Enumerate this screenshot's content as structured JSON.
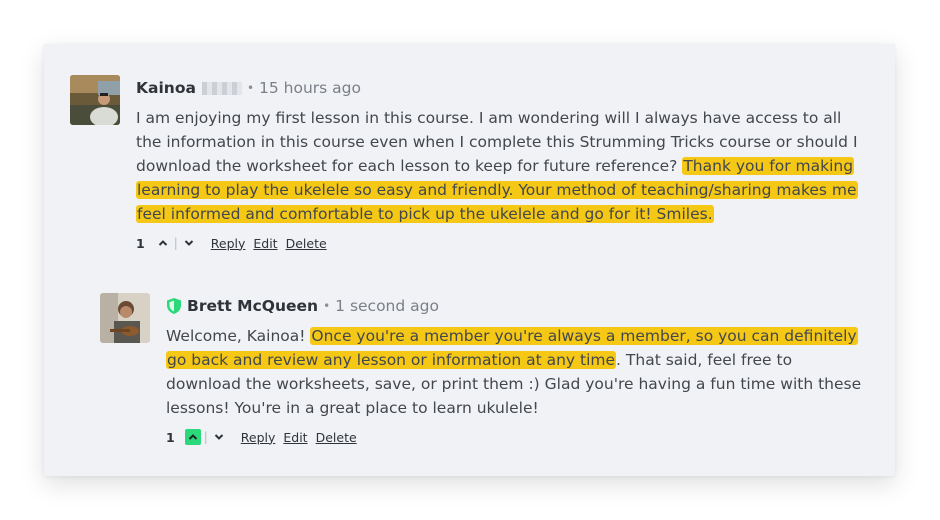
{
  "comments": [
    {
      "author": "Kainoa",
      "time": "15 hours ago",
      "text_plain": "I am enjoying my first lesson in this course. I am wondering will I always have access to all the information in this course even when I complete this Strumming Tricks course or should I download the worksheet for each lesson to keep for future reference? ",
      "text_highlight": "Thank you for making learning to play the ukelele so easy and friendly. Your method of teaching/sharing makes me feel informed and comfortable to pick up the ukelele and go for it! Smiles.",
      "score": "1",
      "upvoted": false,
      "actions": {
        "reply": "Reply",
        "edit": "Edit",
        "delete": "Delete"
      }
    },
    {
      "author": "Brett McQueen",
      "time": "1 second ago",
      "text_intro": "Welcome, Kainoa! ",
      "text_highlight": "Once you're a member you're always a member, so you can definitely go back and review any lesson or information at any time",
      "text_rest": ". That said, feel free to download the worksheets, save, or print them :) Glad you're having a fun time with these lessons! You're in a great place to learn ukulele!",
      "score": "1",
      "upvoted": true,
      "badge_icon": "shield-icon",
      "actions": {
        "reply": "Reply",
        "edit": "Edit",
        "delete": "Delete"
      }
    }
  ],
  "colors": {
    "highlight": "#f6c816",
    "upvote_active": "#2bd97a",
    "moderator_shield": "#2bd97a",
    "card_bg": "#f1f2f5"
  },
  "separator_dot": "•",
  "vote_separator": "|"
}
